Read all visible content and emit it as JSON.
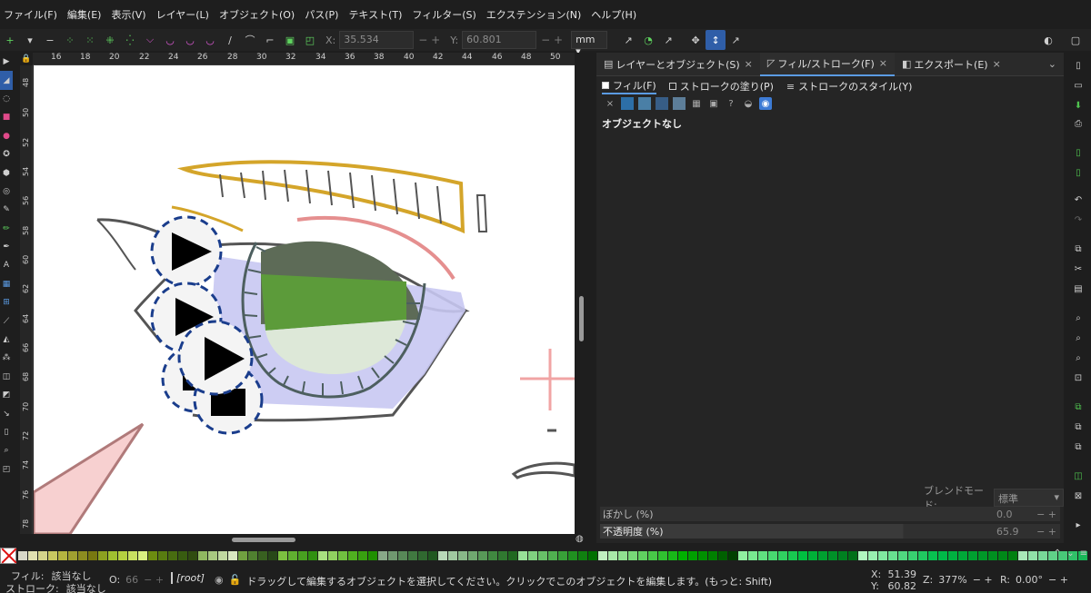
{
  "menu": [
    "ファイル(F)",
    "編集(E)",
    "表示(V)",
    "レイヤー(L)",
    "オブジェクト(O)",
    "パス(P)",
    "テキスト(T)",
    "フィルター(S)",
    "エクステンション(N)",
    "ヘルプ(H)"
  ],
  "toolctrl": {
    "x_label": "X:",
    "x_value": "35.534",
    "y_label": "Y:",
    "y_value": "60.801",
    "unit": "mm",
    "unit_arrow": "▾"
  },
  "ruler_h": [
    "16",
    "18",
    "20",
    "22",
    "24",
    "26",
    "28",
    "30",
    "32",
    "34",
    "36",
    "38",
    "40",
    "42",
    "44",
    "46",
    "48",
    "50"
  ],
  "ruler_v": [
    "48",
    "50",
    "52",
    "54",
    "56",
    "58",
    "60",
    "62",
    "64",
    "66",
    "68",
    "70",
    "72",
    "74",
    "76",
    "78"
  ],
  "dock": {
    "tabs": [
      {
        "label": "レイヤーとオブジェクト(S)",
        "close": "×"
      },
      {
        "label": "フィル/ストローク(F)",
        "close": "×"
      },
      {
        "label": "エクスポート(E)",
        "close": "×"
      }
    ],
    "subtabs": [
      "フィル(F)",
      "ストロークの塗り(P)",
      "ストロークのスタイル(Y)"
    ],
    "no_object": "オブジェクトなし",
    "blend_label": "ブレンドモード:",
    "blend_value": "標準",
    "blur_label": "ぼかし (%)",
    "blur_value": "0.0",
    "opacity_label": "不透明度 (%)",
    "opacity_value": "65.9"
  },
  "status": {
    "fill_label": "フィル:",
    "fill_value": "該当なし",
    "stroke_label": "ストローク:",
    "stroke_value": "該当なし",
    "o_label": "O:",
    "o_value": "66",
    "layer": "[root]",
    "message": "ドラッグして編集するオブジェクトを選択してください。クリックでこのオブジェクトを編集します。(もっと: Shift)",
    "x_label": "X:",
    "x_value": "51.39",
    "y_label": "Y:",
    "y_value": "60.82",
    "zoom_label": "Z:",
    "zoom_value": "377%",
    "rot_label": "R:",
    "rot_value": "0.00°"
  },
  "colors": {
    "accent": "#5b9be3",
    "canvas": "#ffffff",
    "eyebrow": "#d4a52a",
    "iris_dark": "#5d6b57",
    "iris_green": "#5c9b3a",
    "iris_light": "#dde8d8",
    "eye_shadow": "#c8c8f2",
    "handle_outline": "#1a3d8c"
  },
  "palette": [
    "#d8d8c8",
    "#e0e0b0",
    "#d4d48a",
    "#c8c860",
    "#b4b440",
    "#a0a030",
    "#8c8c20",
    "#787810",
    "#8ca020",
    "#a0c030",
    "#b4d040",
    "#c8e060",
    "#d8f080",
    "#6c8c10",
    "#587c10",
    "#486c10",
    "#385c10",
    "#304c10",
    "#90b860",
    "#a8c880",
    "#c0d8a0",
    "#d8e8c0",
    "#70a040",
    "#508030",
    "#386020",
    "#284818",
    "#7cc040",
    "#60b030",
    "#48a020",
    "#309010",
    "#a8e080",
    "#90d060",
    "#70c040",
    "#50b020",
    "#38a010",
    "#209000",
    "#88a888",
    "#709870",
    "#588858",
    "#407840",
    "#306830",
    "#205820",
    "#b8d8b8",
    "#a0c8a0",
    "#88b888",
    "#70a870",
    "#589858",
    "#408840",
    "#307830",
    "#206820",
    "#98e098",
    "#80d080",
    "#68c068",
    "#50b050",
    "#38a038",
    "#209020",
    "#108010",
    "#007000",
    "#c0f0c0",
    "#a8e8a8",
    "#90e090",
    "#78d878",
    "#60d060",
    "#48c848",
    "#30c030",
    "#18b818",
    "#00b000",
    "#00a000",
    "#009000",
    "#008000",
    "#006000",
    "#004000",
    "#90f0a0",
    "#78e890",
    "#60e080",
    "#48d870",
    "#30d060",
    "#18c850",
    "#00c040",
    "#00b038",
    "#00a030",
    "#009028",
    "#008020",
    "#007018",
    "#b0f8c0",
    "#98f0b0",
    "#80e8a0",
    "#68e090",
    "#50d880",
    "#38d070",
    "#20c860",
    "#08c050",
    "#00b848",
    "#00b040",
    "#00a838",
    "#00a030",
    "#009828",
    "#009020",
    "#008818",
    "#008010",
    "#a8e8b8",
    "#90e0a8",
    "#78d898",
    "#60d088",
    "#48c878",
    "#30c068",
    "#18b858"
  ]
}
